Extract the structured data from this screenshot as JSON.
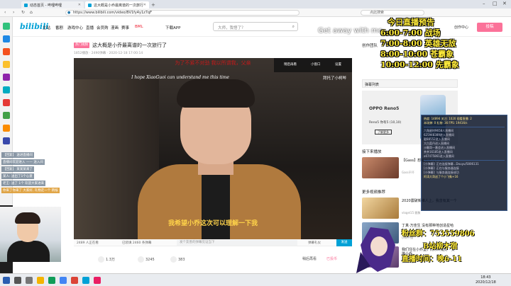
{
  "browser": {
    "tabs": [
      {
        "label": "动态首页 - 哔哩哔哩"
      },
      {
        "label": "这大概是小乔最离谱的一次旅行"
      }
    ],
    "url": "https://www.bilibili.com/video/BV1fy4y1z7qF",
    "search_placeholder": "点此搜索"
  },
  "header": {
    "logo": "bilibili",
    "nav": [
      "主站",
      "番剧",
      "游戏中心",
      "直播",
      "会员购",
      "漫画",
      "赛事",
      "BML",
      "下载APP"
    ],
    "search_placeholder": "大师，我悟了？",
    "right_nav": [
      "大会员",
      "消息",
      "动态",
      "收藏",
      "历史",
      "创作中心"
    ],
    "contribute": "投稿"
  },
  "video": {
    "badge": "热门视频",
    "title": "这大概是小乔最离谱的一次旅行了",
    "meta": "1852播放 · 2490弹幕 · 2020-12-18 17:00:14",
    "subtitle_top_cn": "为了不紧不对劲 我以所谓我，父亲",
    "subtitle_top_en": "I hope XiaoGuoi can understand me this time",
    "subtitle_bottom": "我希望小乔这次可以理解一下我",
    "watermark": "拜托了小柯哔",
    "mini_buttons": [
      "稍后再看",
      "小窗口",
      "设置"
    ]
  },
  "player_bar": {
    "viewers": "2489 人正在看",
    "danmu_count": "已装填 2460 条弹幕",
    "danmu_placeholder": "发个友善的弹幕见证当下",
    "etiquette": "弹幕礼仪",
    "send": "发送"
  },
  "actions": {
    "like": "1.3万",
    "coin": "3245",
    "fav": "383",
    "share": "稍后再看",
    "report": "已投币"
  },
  "right": {
    "creators": "创作团队",
    "danmu_list": "弹幕列表",
    "ad_brand": "OPPO Reno5",
    "ad_text": "Reno5 你有5 (10,10)",
    "ad_btn": "了解更多",
    "next_up": "接下来播放",
    "more": "更多视频推荐",
    "recs": [
      {
        "title": "【Gass】想唱出这几个字",
        "author": "Gass不坏",
        "stats": "1.2万 · 75"
      },
      {
        "title": "2020震破新维人上，我曾有其一个",
        "author": "vlogel15 雅聚",
        "stats": "5.6万 · 68"
      },
      {
        "title": "丁真·万佳生 没有那种地创造星哈",
        "author": "伊朗不懂",
        "stats": "3.6万 · 93"
      },
      {
        "title": "我们住在小乔里，而你终是好 · 安排小乔",
        "author": "伊人小编",
        "stats": "7071 · 44"
      }
    ]
  },
  "overlay": {
    "schedule": [
      "今日直播预告",
      "6:00-7:00 战场",
      "7:00-8:00 英雄无敌",
      "8:00-10:00 苍霸象",
      "10:00-12:00 先霸象"
    ],
    "get_away": "Get away with me",
    "qq_group": "粉丝群：753559806",
    "channel": "B站柳木宿",
    "live_time": "直播时间：晚6-11",
    "stats_rows": [
      "热度: 14894    关注: 1020    观看直播: 2",
      "本场弹: 0     礼物: 36      FPS: 19416/s",
      "六角星时9658人直播间",
      "625948389进入直播间",
      "聪88552进入直播间",
      "大白菜丹进入直播间",
      "沙雕哥一番会进入直播间",
      "茶茶16185进入直播间",
      "a67475861进入直播间",
      "[小弹幕]: 正在连接弹幕...Douyu/5806131",
      "[小弹幕]: 正在与服务器连接",
      "[小弹幕]: 与服务器连接成功",
      "阿涛大哥送了个小飞象+16"
    ],
    "chat": [
      {
        "text": "【回复】 送进直播间"
      },
      {
        "text": "直播间欢迎进入 —— 送入间"
      },
      {
        "text": "【回复】 某某某来了"
      },
      {
        "text": "某人: 送出了1个心意"
      },
      {
        "text": "老王: 送了 1个 欢迎大家进来"
      },
      {
        "text": "你来了你来了 大家好, 礼物走一个 稍候"
      }
    ]
  },
  "clock": {
    "time": "18:43",
    "date": "2020/12/18"
  }
}
